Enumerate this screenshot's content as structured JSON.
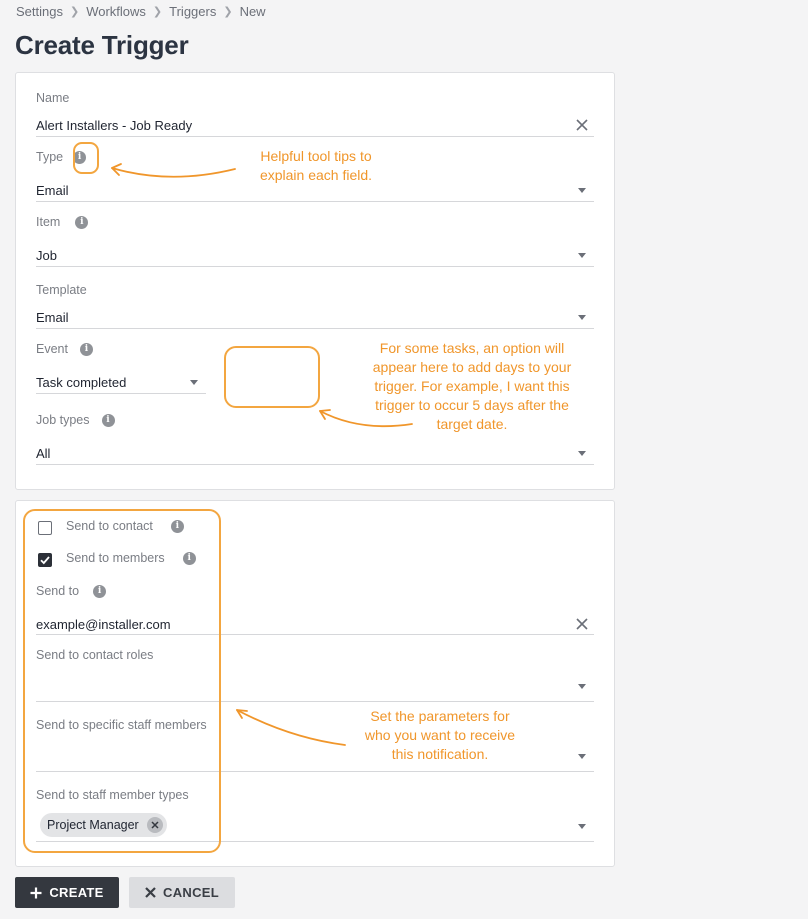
{
  "breadcrumb": [
    "Settings",
    "Workflows",
    "Triggers",
    "New"
  ],
  "page_title": "Create Trigger",
  "form": {
    "name_label": "Name",
    "name_value": "Alert Installers - Job Ready",
    "type_label": "Type",
    "type_value": "Email",
    "item_label": "Item",
    "item_value": "Job",
    "template_label": "Template",
    "template_value": "Email",
    "event_label": "Event",
    "event_value": "Task completed",
    "job_types_label": "Job types",
    "job_types_value": "All"
  },
  "recipients": {
    "send_to_contact_label": "Send to contact",
    "send_to_contact_checked": false,
    "send_to_members_label": "Send to members",
    "send_to_members_checked": true,
    "send_to_label": "Send to",
    "send_to_value": "example@installer.com",
    "contact_roles_label": "Send to contact roles",
    "staff_members_label": "Send to specific staff members",
    "staff_types_label": "Send to staff member types",
    "staff_types_chip": "Project Manager"
  },
  "buttons": {
    "create_label": "CREATE",
    "cancel_label": "CANCEL"
  },
  "annotations": {
    "tooltips_line1": "Helpful tool tips to",
    "tooltips_line2": "explain each field.",
    "days_line1": "For some tasks, an option will",
    "days_line2": "appear here to add days to your",
    "days_line3": "trigger. For example, I want this",
    "days_line4": "trigger to occur 5 days after the",
    "days_line5": "target date.",
    "params_line1": "Set the parameters for",
    "params_line2": "who you want to receive",
    "params_line3": "this notification."
  },
  "colors": {
    "annotation": "#f0962b",
    "primary_button": "#34383f",
    "secondary_button": "#dcdde0"
  },
  "icons": [
    "chevron-right-icon",
    "info-icon",
    "close-icon",
    "caret-down-icon",
    "checkmark-icon",
    "plus-icon"
  ]
}
